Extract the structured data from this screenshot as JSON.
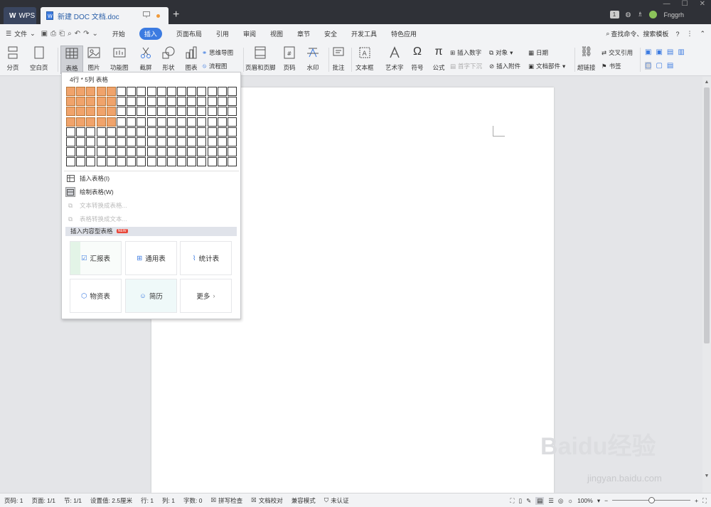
{
  "titlebar": {
    "app_tab": "WPS",
    "doc_tab": "新建 DOC 文档.doc",
    "user": "Fnggrh",
    "badge": "1"
  },
  "menu": {
    "file": "文件",
    "tabs": [
      {
        "label": "开始",
        "active": false
      },
      {
        "label": "插入",
        "active": true
      },
      {
        "label": "页面布局",
        "active": false
      },
      {
        "label": "引用",
        "active": false
      },
      {
        "label": "审阅",
        "active": false
      },
      {
        "label": "视图",
        "active": false
      },
      {
        "label": "章节",
        "active": false
      },
      {
        "label": "安全",
        "active": false
      },
      {
        "label": "开发工具",
        "active": false
      },
      {
        "label": "特色应用",
        "active": false
      }
    ],
    "search": "查找命令、搜索模板",
    "help": "?"
  },
  "ribbon": {
    "page_break": "分页",
    "blank_page": "空白页",
    "table": "表格",
    "picture": "图片",
    "function_chart": "功能图",
    "screenshot": "截屏",
    "shape": "形状",
    "chart": "图表",
    "mindmap": "思维导图",
    "flowchart": "流程图",
    "header_footer": "页眉和页脚",
    "page_number": "页码",
    "watermark": "水印",
    "comment": "批注",
    "textbox": "文本框",
    "wordart": "艺术字",
    "symbol": "符号",
    "formula": "公式",
    "insert_number": "插入数字",
    "drop_cap": "首字下沉",
    "object": "对象",
    "attachment": "插入附件",
    "date": "日期",
    "doc_parts": "文档部件",
    "hyperlink": "超链接",
    "cross_ref": "交叉引用",
    "bookmark": "书签"
  },
  "table_dropdown": {
    "size_label": "4行 * 5列 表格",
    "selected_rows": 4,
    "selected_cols": 5,
    "grid_rows": 8,
    "grid_cols": 17,
    "insert_table": "插入表格(I)",
    "draw_table": "绘制表格(W)",
    "text_to_table": "文本转换成表格...",
    "table_to_text": "表格转换成文本...",
    "content_header": "插入内容型表格",
    "new_badge": "NEW",
    "cards": [
      "汇报表",
      "通用表",
      "统计表",
      "物资表",
      "简历",
      "更多"
    ]
  },
  "status": {
    "page": "页码: 1",
    "pages": "页面: 1/1",
    "section": "节: 1/1",
    "setting": "设置值: 2.5厘米",
    "row": "行: 1",
    "col": "列: 1",
    "words": "字数: 0",
    "spell": "拼写检查",
    "proof": "文档校对",
    "compat": "兼容模式",
    "auth": "未认证",
    "zoom": "100%",
    "zoom_level": 0.5
  },
  "watermark": {
    "main": "Baidu经验",
    "sub": "jingyan.baidu.com"
  },
  "colors": {
    "accent": "#3c7be1",
    "grid_selected": "#f0a36b",
    "titlebar": "#2f3137"
  }
}
